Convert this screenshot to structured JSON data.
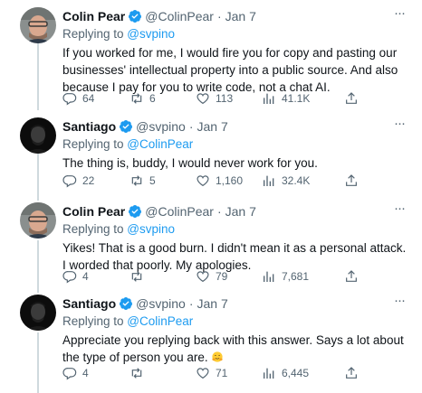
{
  "colors": {
    "accent": "#1d9bf0",
    "muted": "#536471",
    "text": "#0f1419",
    "line": "#cfd9de"
  },
  "tweets": [
    {
      "name": "Colin Pear",
      "handle": "@ColinPear",
      "date": "Jan 7",
      "replying_label": "Replying to ",
      "replying_to": "@svpino",
      "text": "If you worked for me, I would fire you for copy and pasting our businesses' intellectual property into a public source. And also because I pay for you to write code, not a chat AI.",
      "replies": "64",
      "retweets": "6",
      "likes": "113",
      "views": "41.1K",
      "avatar": "light-face"
    },
    {
      "name": "Santiago",
      "handle": "@svpino",
      "date": "Jan 7",
      "replying_label": "Replying to ",
      "replying_to": "@ColinPear",
      "text": "The thing is, buddy, I would never work for you.",
      "replies": "22",
      "retweets": "5",
      "likes": "1,160",
      "views": "32.4K",
      "avatar": "dark-face"
    },
    {
      "name": "Colin Pear",
      "handle": "@ColinPear",
      "date": "Jan 7",
      "replying_label": "Replying to ",
      "replying_to": "@svpino",
      "text": "Yikes! That is a good burn. I didn't mean it as a personal attack. I worded that poorly. My apologies.",
      "replies": "4",
      "retweets": "",
      "likes": "79",
      "views": "7,681",
      "avatar": "light-face"
    },
    {
      "name": "Santiago",
      "handle": "@svpino",
      "date": "Jan 7",
      "replying_label": "Replying to ",
      "replying_to": "@ColinPear",
      "text": "Appreciate you replying back with this answer. Says a lot about the type of person you are.",
      "emoji": "hugging-face-emoji",
      "replies": "4",
      "retweets": "",
      "likes": "71",
      "views": "6,445",
      "avatar": "dark-face"
    }
  ],
  "icons": {
    "more": "more-options-icon",
    "verified": "verified-badge-icon",
    "reply": "reply-icon",
    "retweet": "retweet-icon",
    "like": "like-icon",
    "views": "views-icon",
    "share": "share-icon"
  }
}
